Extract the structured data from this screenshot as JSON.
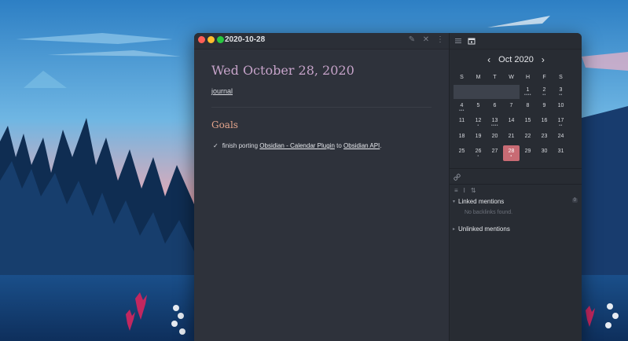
{
  "window": {
    "tab_title": "2020-10-28"
  },
  "note": {
    "heading": "Wed October 28, 2020",
    "tag_link": "journal",
    "section_heading": "Goals",
    "task": {
      "prefix": "finish porting ",
      "link1": "Obsidian - Calendar Plugin",
      "middle": " to ",
      "link2": "Obsidian API",
      "suffix": "."
    }
  },
  "calendar": {
    "month_label": "Oct 2020",
    "prev_icon": "chevron-left-icon",
    "next_icon": "chevron-right-icon",
    "weekdays": [
      "S",
      "M",
      "T",
      "W",
      "H",
      "F",
      "S"
    ],
    "weeks": [
      [
        {
          "day": "",
          "dots": ""
        },
        {
          "day": "",
          "dots": ""
        },
        {
          "day": "",
          "dots": ""
        },
        {
          "day": "",
          "dots": ""
        },
        {
          "day": "1",
          "dots": "••••"
        },
        {
          "day": "2",
          "dots": "••"
        },
        {
          "day": "3",
          "dots": "••"
        }
      ],
      [
        {
          "day": "4",
          "dots": "•••"
        },
        {
          "day": "5",
          "dots": ""
        },
        {
          "day": "6",
          "dots": ""
        },
        {
          "day": "7",
          "dots": ""
        },
        {
          "day": "8",
          "dots": ""
        },
        {
          "day": "9",
          "dots": ""
        },
        {
          "day": "10",
          "dots": ""
        }
      ],
      [
        {
          "day": "11",
          "dots": ""
        },
        {
          "day": "12",
          "dots": "•"
        },
        {
          "day": "13",
          "dots": "••••"
        },
        {
          "day": "14",
          "dots": ""
        },
        {
          "day": "15",
          "dots": ""
        },
        {
          "day": "16",
          "dots": ""
        },
        {
          "day": "17",
          "dots": "••"
        }
      ],
      [
        {
          "day": "18",
          "dots": ""
        },
        {
          "day": "19",
          "dots": ""
        },
        {
          "day": "20",
          "dots": ""
        },
        {
          "day": "21",
          "dots": ""
        },
        {
          "day": "22",
          "dots": ""
        },
        {
          "day": "23",
          "dots": ""
        },
        {
          "day": "24",
          "dots": ""
        }
      ],
      [
        {
          "day": "25",
          "dots": ""
        },
        {
          "day": "26",
          "dots": "•"
        },
        {
          "day": "27",
          "dots": ""
        },
        {
          "day": "28",
          "dots": "•",
          "today": true
        },
        {
          "day": "29",
          "dots": ""
        },
        {
          "day": "30",
          "dots": ""
        },
        {
          "day": "31",
          "dots": ""
        }
      ]
    ],
    "today_color": "#c86b74"
  },
  "backlinks": {
    "linked_label": "Linked mentions",
    "linked_count": "0",
    "empty_text": "No backlinks found.",
    "unlinked_label": "Unlinked mentions"
  },
  "colors": {
    "heading": "#c6a3c9",
    "section": "#e5a58c",
    "editor_bg": "#2e323b",
    "sidebar_bg": "#282c33"
  }
}
